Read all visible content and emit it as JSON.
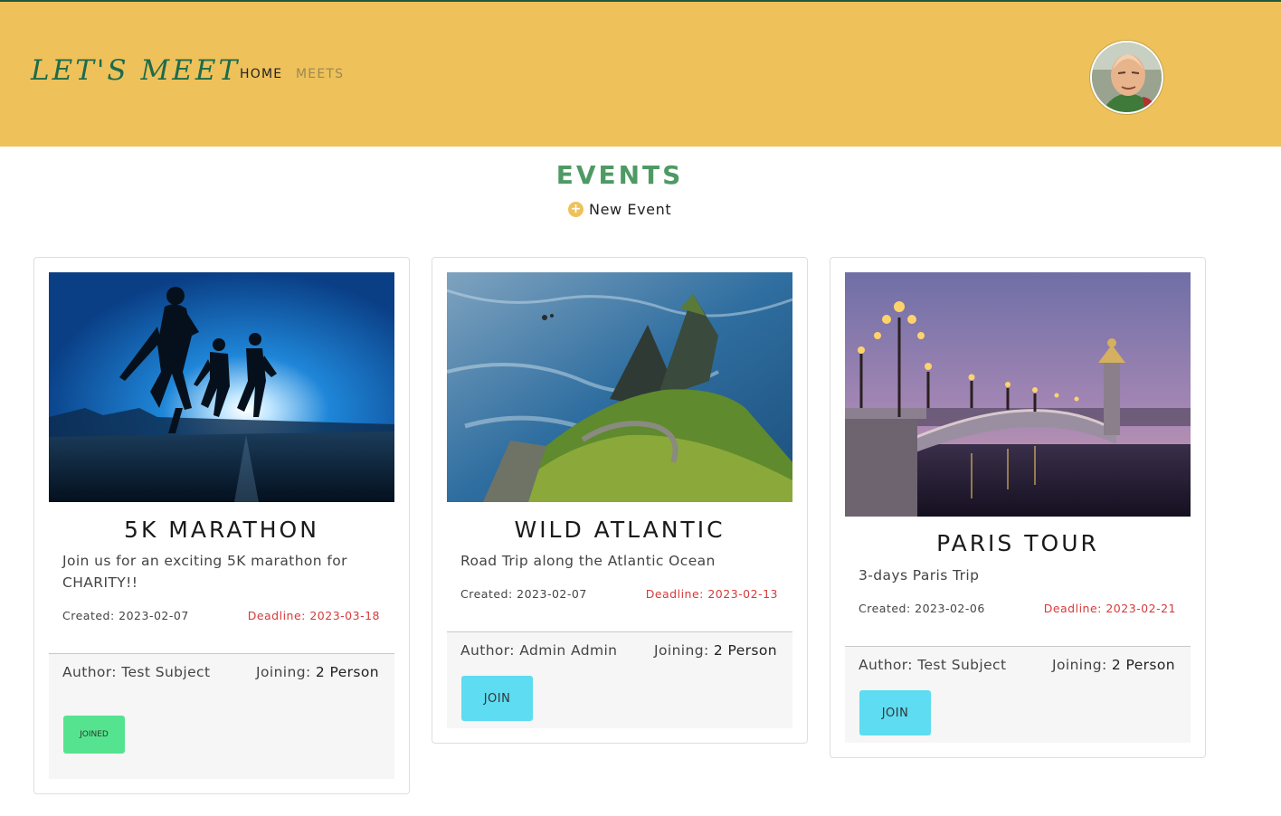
{
  "header": {
    "brand": "LET'S MEET",
    "nav": [
      {
        "label": "HOME",
        "active": true
      },
      {
        "label": "MEETS",
        "active": false
      }
    ],
    "avatar_icon": "user-avatar"
  },
  "page": {
    "title": "EVENTS",
    "new_event_label": "New Event",
    "new_event_icon": "plus-circle-icon"
  },
  "labels": {
    "author_prefix": "Author: ",
    "joining_prefix": "Joining: ",
    "created_prefix": "Created: ",
    "deadline_prefix": "Deadline: "
  },
  "events": [
    {
      "title": "5K MARATHON",
      "description": "Join us for an exciting 5K marathon for CHARITY!!",
      "created": "Created: 2023-02-07",
      "deadline": "Deadline: 2023-03-18",
      "author": "Author: Test Subject",
      "joining_label": "Joining: ",
      "joining_count": "2 Person",
      "action_label": "JOINED",
      "action_state": "joined",
      "image": "runners-silhouette"
    },
    {
      "title": "WILD ATLANTIC",
      "description": "Road Trip along the Atlantic Ocean",
      "created": "Created: 2023-02-07",
      "deadline": "Deadline: 2023-02-13",
      "author": "Author: Admin Admin",
      "joining_label": "Joining: ",
      "joining_count": "2 Person",
      "action_label": "JOIN",
      "action_state": "join",
      "image": "coastal-cliffs"
    },
    {
      "title": "PARIS TOUR",
      "description": "3-days Paris Trip",
      "created": "Created: 2023-02-06",
      "deadline": "Deadline: 2023-02-21",
      "author": "Author: Test Subject",
      "joining_label": "Joining: ",
      "joining_count": "2 Person",
      "action_label": "JOIN",
      "action_state": "join",
      "image": "paris-bridge"
    }
  ],
  "colors": {
    "header_bg": "#eec15a",
    "brand": "#1e6b4a",
    "title": "#4e9a64",
    "join_button": "#5edcf1",
    "joined_button": "#56e38f",
    "deadline": "#d63a3a"
  }
}
